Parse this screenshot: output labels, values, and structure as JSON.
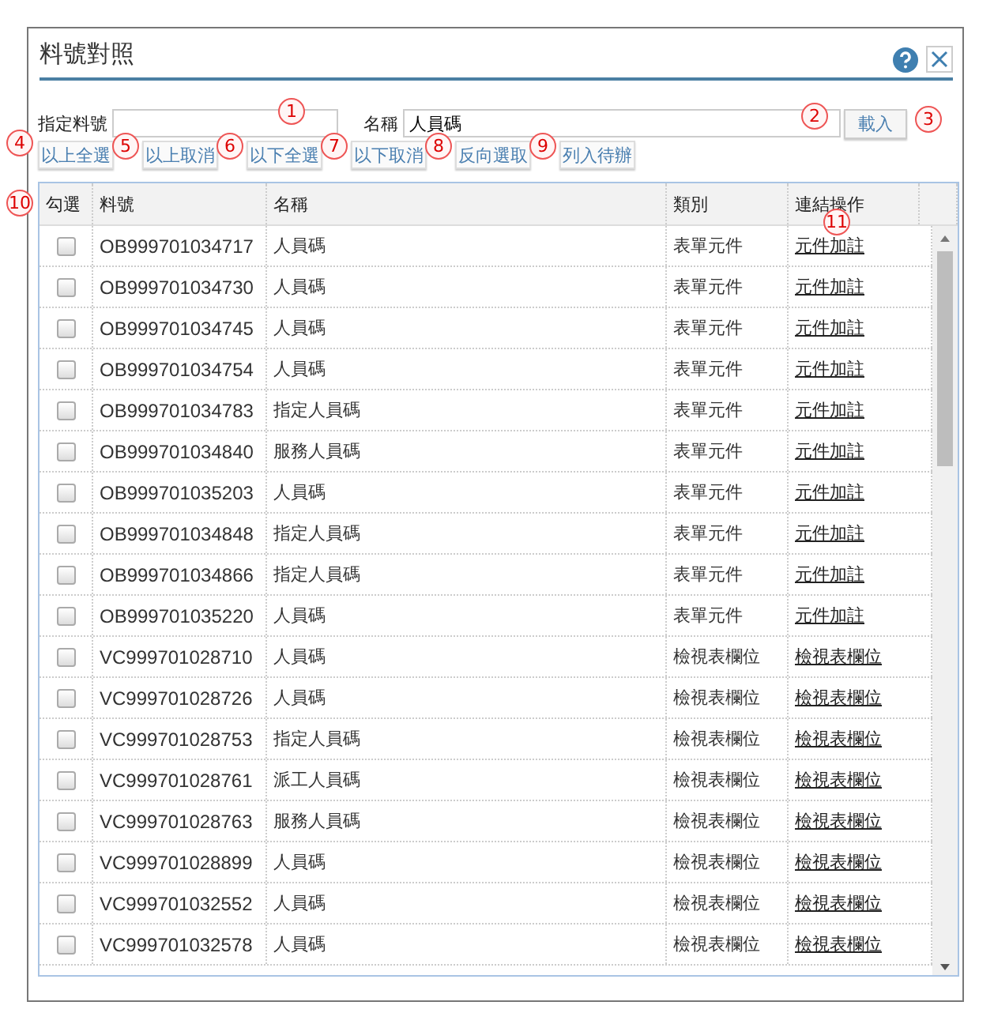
{
  "dialog": {
    "title": "料號對照"
  },
  "form": {
    "code_label": "指定料號",
    "name_label": "名稱",
    "name_value": "人員碼",
    "load_button": "載入"
  },
  "actions": [
    "以上全選",
    "以上取消",
    "以下全選",
    "以下取消",
    "反向選取",
    "列入待辦"
  ],
  "table": {
    "columns": [
      "勾選",
      "料號",
      "名稱",
      "類別",
      "連結操作"
    ],
    "rows": [
      {
        "checked": false,
        "code": "OB999701034717",
        "name": "人員碼",
        "type": "表單元件",
        "link": "元件加註"
      },
      {
        "checked": false,
        "code": "OB999701034730",
        "name": "人員碼",
        "type": "表單元件",
        "link": "元件加註"
      },
      {
        "checked": false,
        "code": "OB999701034745",
        "name": "人員碼",
        "type": "表單元件",
        "link": "元件加註"
      },
      {
        "checked": false,
        "code": "OB999701034754",
        "name": "人員碼",
        "type": "表單元件",
        "link": "元件加註"
      },
      {
        "checked": false,
        "code": "OB999701034783",
        "name": "指定人員碼",
        "type": "表單元件",
        "link": "元件加註"
      },
      {
        "checked": false,
        "code": "OB999701034840",
        "name": "服務人員碼",
        "type": "表單元件",
        "link": "元件加註"
      },
      {
        "checked": false,
        "code": "OB999701035203",
        "name": "人員碼",
        "type": "表單元件",
        "link": "元件加註"
      },
      {
        "checked": false,
        "code": "OB999701034848",
        "name": "指定人員碼",
        "type": "表單元件",
        "link": "元件加註"
      },
      {
        "checked": false,
        "code": "OB999701034866",
        "name": "指定人員碼",
        "type": "表單元件",
        "link": "元件加註"
      },
      {
        "checked": false,
        "code": "OB999701035220",
        "name": "人員碼",
        "type": "表單元件",
        "link": "元件加註"
      },
      {
        "checked": false,
        "code": "VC999701028710",
        "name": "人員碼",
        "type": "檢視表欄位",
        "link": "檢視表欄位"
      },
      {
        "checked": false,
        "code": "VC999701028726",
        "name": "人員碼",
        "type": "檢視表欄位",
        "link": "檢視表欄位"
      },
      {
        "checked": false,
        "code": "VC999701028753",
        "name": "指定人員碼",
        "type": "檢視表欄位",
        "link": "檢視表欄位"
      },
      {
        "checked": false,
        "code": "VC999701028761",
        "name": "派工人員碼",
        "type": "檢視表欄位",
        "link": "檢視表欄位"
      },
      {
        "checked": false,
        "code": "VC999701028763",
        "name": "服務人員碼",
        "type": "檢視表欄位",
        "link": "檢視表欄位"
      },
      {
        "checked": false,
        "code": "VC999701028899",
        "name": "人員碼",
        "type": "檢視表欄位",
        "link": "檢視表欄位"
      },
      {
        "checked": false,
        "code": "VC999701032552",
        "name": "人員碼",
        "type": "檢視表欄位",
        "link": "檢視表欄位"
      },
      {
        "checked": false,
        "code": "VC999701032578",
        "name": "人員碼",
        "type": "檢視表欄位",
        "link": "檢視表欄位"
      }
    ]
  },
  "callouts": [
    "1",
    "2",
    "3",
    "4",
    "5",
    "6",
    "7",
    "8",
    "9",
    "10",
    "11"
  ]
}
